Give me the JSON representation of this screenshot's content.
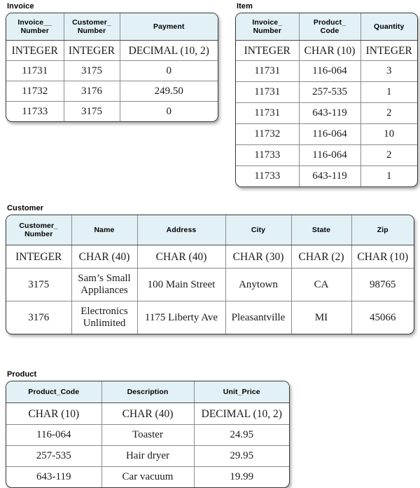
{
  "tables": [
    {
      "title": "Invoice",
      "headers": [
        "Invoice__\nNumber",
        "Customer_\nNumber",
        "Payment"
      ],
      "types": [
        "INTEGER",
        "INTEGER",
        "DECIMAL (10,  2)"
      ],
      "rows": [
        [
          "11731",
          "3175",
          "0"
        ],
        [
          "11732",
          "3176",
          "249.50"
        ],
        [
          "11733",
          "3175",
          "0"
        ]
      ]
    },
    {
      "title": "Item",
      "headers": [
        "Invoice_\nNumber",
        "Product_\nCode",
        "Quantity"
      ],
      "types": [
        "INTEGER",
        "CHAR (10)",
        "INTEGER"
      ],
      "rows": [
        [
          "11731",
          "116-064",
          "3"
        ],
        [
          "11731",
          "257-535",
          "1"
        ],
        [
          "11731",
          "643-119",
          "2"
        ],
        [
          "11732",
          "116-064",
          "10"
        ],
        [
          "11733",
          "116-064",
          "2"
        ],
        [
          "11733",
          "643-119",
          "1"
        ]
      ]
    },
    {
      "title": "Customer",
      "headers": [
        "Customer_\nNumber",
        "Name",
        "Address",
        "City",
        "State",
        "Zip"
      ],
      "types": [
        "INTEGER",
        "CHAR (40)",
        "CHAR (40)",
        "CHAR (30)",
        "CHAR (2)",
        "CHAR (10)"
      ],
      "rows": [
        [
          "3175",
          "Sam’s Small\nAppliances",
          "100 Main Street",
          "Anytown",
          "CA",
          "98765"
        ],
        [
          "3176",
          "Electronics\nUnlimited",
          "1175 Liberty Ave",
          "Pleasantville",
          "MI",
          "45066"
        ]
      ]
    },
    {
      "title": "Product",
      "headers": [
        "Product_Code",
        "Description",
        "Unit_Price"
      ],
      "types": [
        "CHAR (10)",
        "CHAR (40)",
        "DECIMAL (10,  2)"
      ],
      "rows": [
        [
          "116-064",
          "Toaster",
          "24.95"
        ],
        [
          "257-535",
          "Hair dryer",
          "29.95"
        ],
        [
          "643-119",
          "Car vacuum",
          "19.99"
        ]
      ]
    }
  ],
  "colors": {
    "header_background": "#e2f1f5",
    "border": "#8b8b8b",
    "outline": "#3a3a3a",
    "text": "#000000"
  }
}
